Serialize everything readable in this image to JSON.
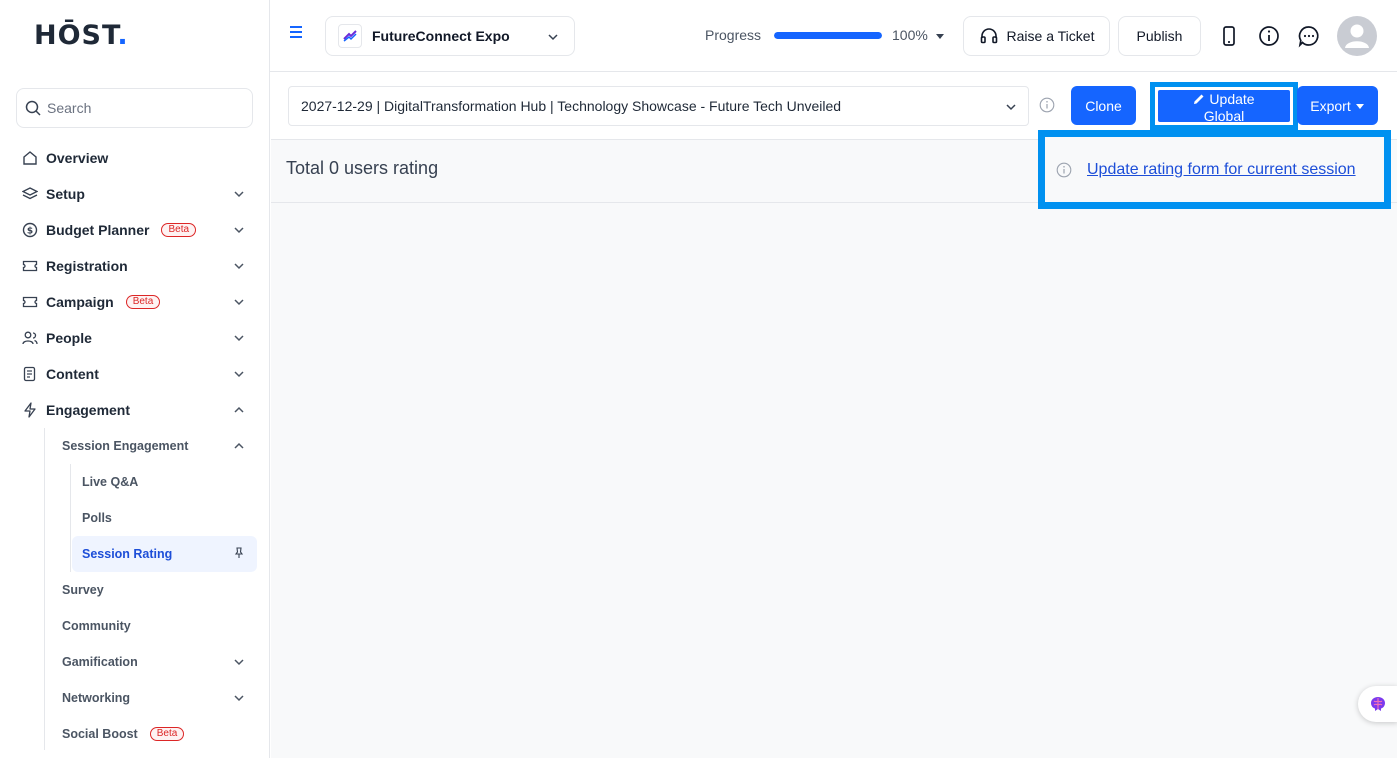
{
  "brand": {
    "logo_main": "HŌST",
    "logo_dot": "."
  },
  "search": {
    "placeholder": "Search"
  },
  "sidebar": {
    "items": [
      {
        "label": "Overview",
        "icon": "home-icon"
      },
      {
        "label": "Setup",
        "icon": "layers-icon"
      },
      {
        "label": "Budget Planner",
        "icon": "dollar-icon",
        "badge": "Beta"
      },
      {
        "label": "Registration",
        "icon": "ticket-icon"
      },
      {
        "label": "Campaign",
        "icon": "ticket-icon",
        "badge": "Beta"
      },
      {
        "label": "People",
        "icon": "people-icon"
      },
      {
        "label": "Content",
        "icon": "document-icon"
      },
      {
        "label": "Engagement",
        "icon": "lightning-icon"
      }
    ],
    "engagement_sub": [
      {
        "label": "Session Engagement"
      },
      {
        "label": "Survey"
      },
      {
        "label": "Community"
      },
      {
        "label": "Gamification"
      },
      {
        "label": "Networking"
      },
      {
        "label": "Social Boost",
        "badge": "Beta"
      }
    ],
    "session_engagement_sub": [
      {
        "label": "Live Q&A"
      },
      {
        "label": "Polls"
      },
      {
        "label": "Session Rating"
      }
    ]
  },
  "topbar": {
    "event_name": "FutureConnect Expo",
    "progress_label": "Progress",
    "progress_percent": "100%",
    "progress_value": 1.0,
    "raise_ticket": "Raise a Ticket",
    "publish": "Publish"
  },
  "session": {
    "selected": "2027-12-29 | DigitalTransformation Hub | Technology Showcase - Future Tech Unveiled",
    "clone": "Clone",
    "update_global_line1": "Update",
    "update_global_line2": "Global",
    "export": "Export"
  },
  "rating": {
    "total": "Total 0 users rating",
    "update_link": "Update rating form for current session"
  },
  "colors": {
    "accent": "#1565ff",
    "highlight": "#0091f0",
    "beta": "#dc2626"
  }
}
